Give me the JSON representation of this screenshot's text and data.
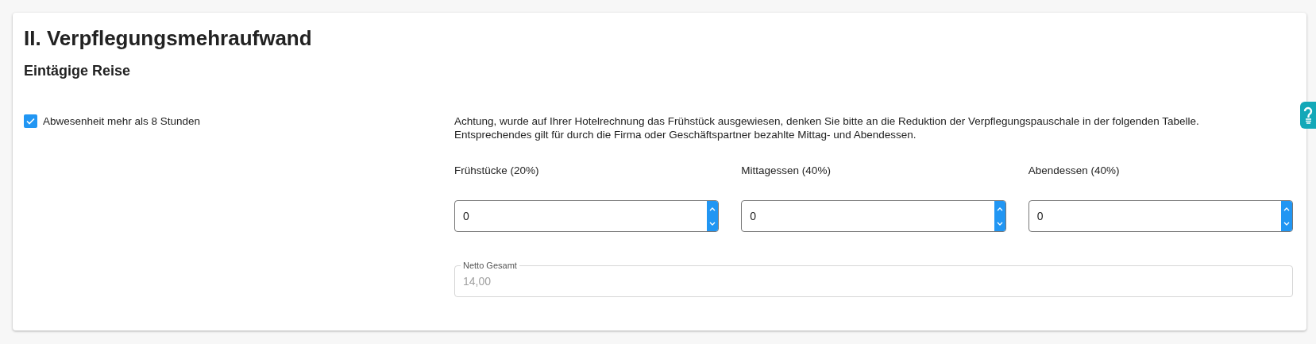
{
  "title": "II. Verpflegungsmehraufwand",
  "subtitle": "Eintägige Reise",
  "absence": {
    "label": "Abwesenheit mehr als 8 Stunden",
    "checked": true
  },
  "notice": "Achtung, wurde auf Ihrer Hotelrechnung das Frühstück ausgewiesen, denken Sie bitte an die Reduktion der Verpflegungspauschale in der folgenden Tabelle.\nEntsprechendes gilt für durch die Firma oder Geschäftspartner bezahlte Mittag- und Abendessen.",
  "meals": [
    {
      "label": "Frühstücke (20%)",
      "value": "0"
    },
    {
      "label": "Mittagessen (40%)",
      "value": "0"
    },
    {
      "label": "Abendessen (40%)",
      "value": "0"
    }
  ],
  "total": {
    "label": "Netto Gesamt",
    "value": "14,00",
    "disabled": true
  }
}
